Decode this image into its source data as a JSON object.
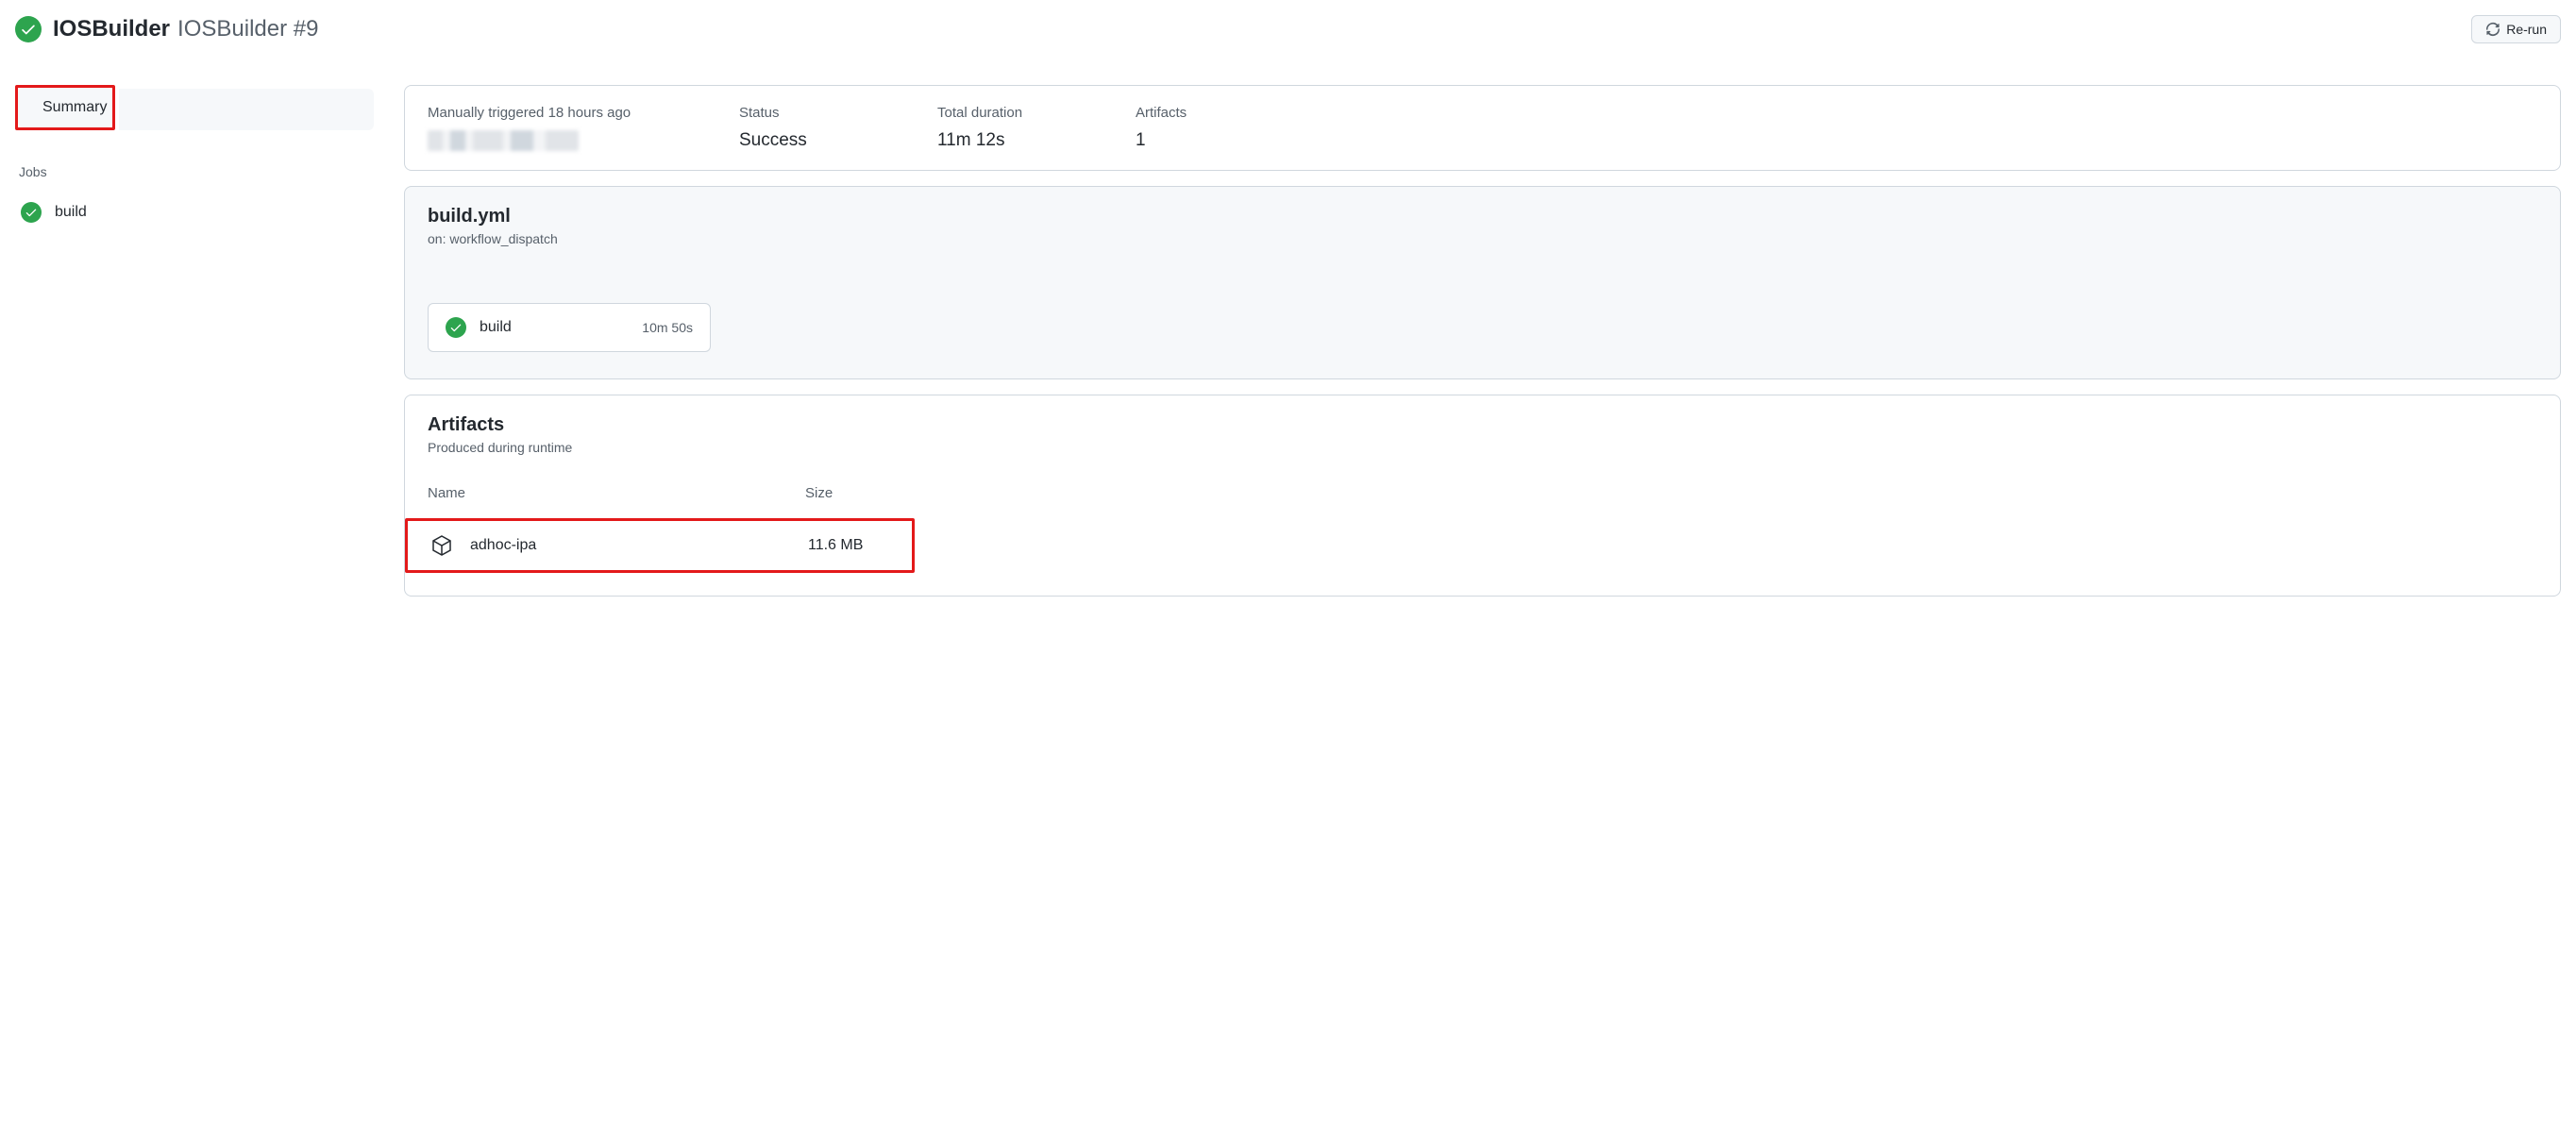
{
  "header": {
    "title_bold": "IOSBuilder",
    "title_sub": "IOSBuilder #9",
    "rerun_label": "Re-run"
  },
  "sidebar": {
    "summary_label": "Summary",
    "jobs_label": "Jobs",
    "jobs": [
      {
        "name": "build"
      }
    ]
  },
  "meta": {
    "trigger_label": "Manually triggered 18 hours ago",
    "status_label": "Status",
    "status_value": "Success",
    "duration_label": "Total duration",
    "duration_value": "11m 12s",
    "artifacts_label": "Artifacts",
    "artifacts_value": "1"
  },
  "workflow": {
    "file": "build.yml",
    "on_label": "on: workflow_dispatch",
    "job_name": "build",
    "job_duration": "10m 50s"
  },
  "artifacts": {
    "title": "Artifacts",
    "subtitle": "Produced during runtime",
    "col_name": "Name",
    "col_size": "Size",
    "rows": [
      {
        "name": "adhoc-ipa",
        "size": "11.6 MB"
      }
    ]
  }
}
